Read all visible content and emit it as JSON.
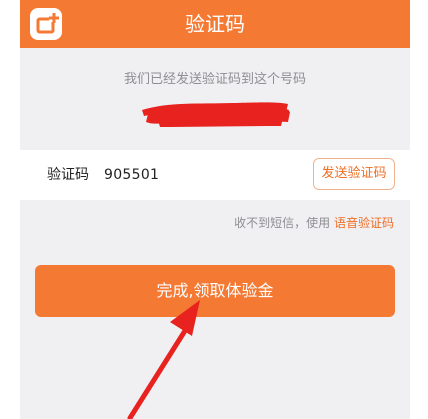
{
  "header": {
    "title": "验证码",
    "back_icon": "back-square-icon"
  },
  "info": {
    "sent_message": "我们已经发送验证码到这个号码"
  },
  "code_row": {
    "label": "验证码",
    "value": "905501",
    "send_button_label": "发送验证码"
  },
  "voice": {
    "prefix": "收不到短信，使用",
    "link_label": "语音验证码"
  },
  "primary_button": {
    "label": "完成,领取体验金"
  },
  "colors": {
    "accent": "#f47a34",
    "background": "#f0f0f2",
    "annotation_red": "#e8231f"
  }
}
